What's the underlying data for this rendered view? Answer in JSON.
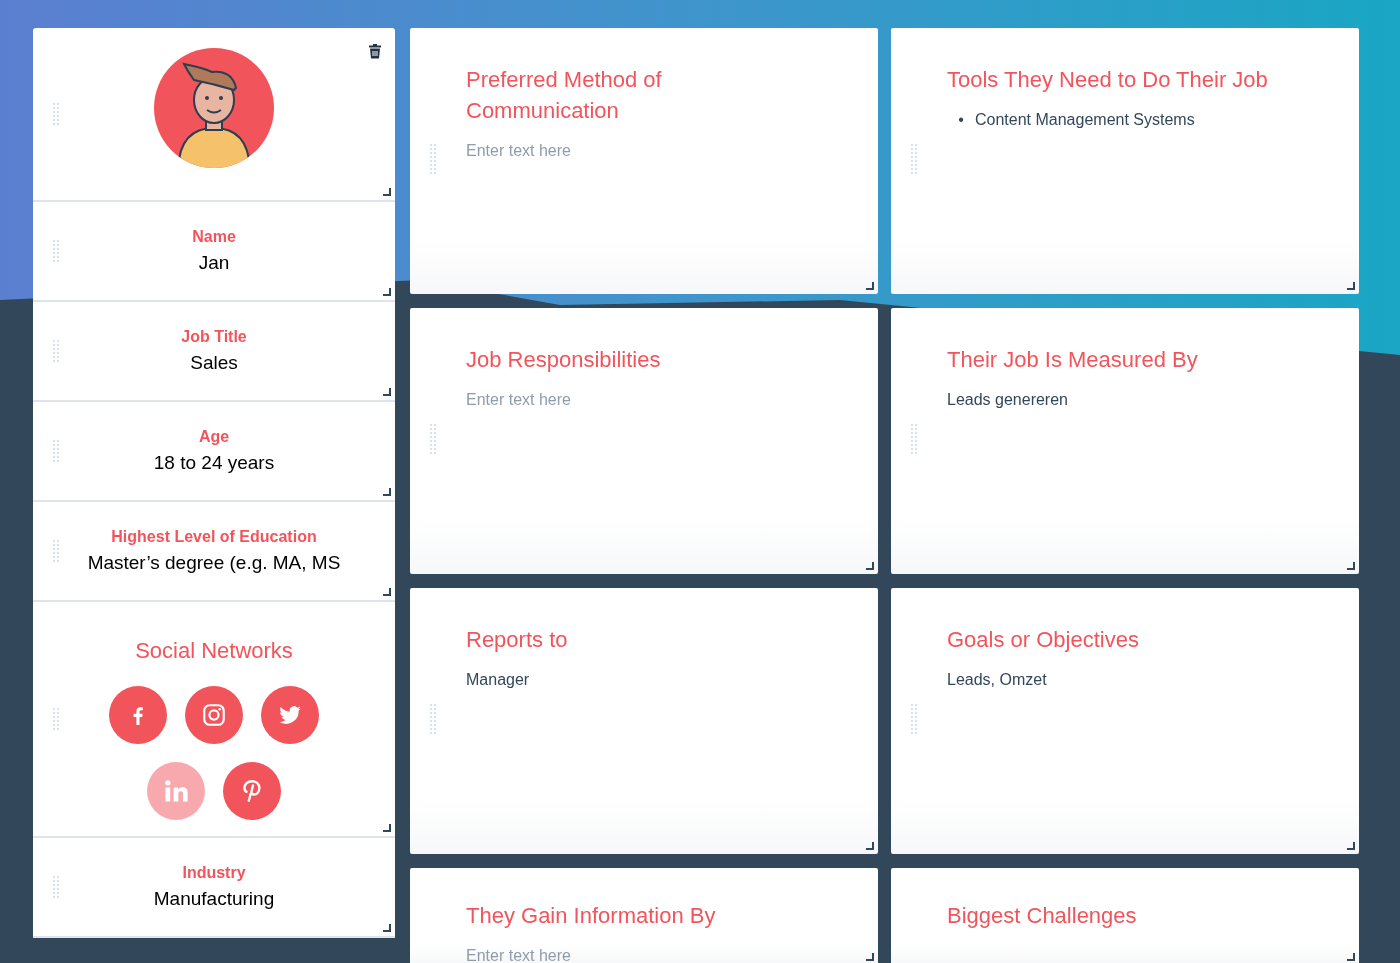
{
  "profile_cards": [
    {
      "kind": "avatar"
    },
    {
      "kind": "field",
      "label": "Name",
      "value": "Jan"
    },
    {
      "kind": "field",
      "label": "Job Title",
      "value": "Sales"
    },
    {
      "kind": "field",
      "label": "Age",
      "value": "18 to 24 years"
    },
    {
      "kind": "field",
      "label": "Highest Level of Education",
      "value": "Master’s degree (e.g. MA, MS"
    },
    {
      "kind": "social",
      "label": "Social Networks",
      "networks": [
        {
          "kind": "facebook",
          "active": true
        },
        {
          "kind": "instagram",
          "active": true
        },
        {
          "kind": "twitter",
          "active": true
        },
        {
          "kind": "linkedin",
          "active": false
        },
        {
          "kind": "pinterest",
          "active": true
        }
      ]
    },
    {
      "kind": "field",
      "label": "Industry",
      "value": "Manufacturing"
    }
  ],
  "detail_cards": [
    {
      "kind": "text",
      "title": "Preferred Method of Communication",
      "placeholder": "Enter text here"
    },
    {
      "kind": "list",
      "title": "Tools They Need to Do Their Job",
      "items": [
        {
          "bullet": "•",
          "text": "Content Management Systems"
        }
      ]
    },
    {
      "kind": "text",
      "title": "Job Responsibilities",
      "placeholder": "Enter text here"
    },
    {
      "kind": "text",
      "title": "Their Job Is Measured By",
      "value": "Leads genereren"
    },
    {
      "kind": "text",
      "title": "Reports to",
      "value": "Manager"
    },
    {
      "kind": "text",
      "title": "Goals or Objectives",
      "value": "Leads, Omzet"
    },
    {
      "kind": "text",
      "title": "They Gain Information By",
      "placeholder": "Enter text here"
    },
    {
      "kind": "text",
      "title": "Biggest Challenges"
    }
  ]
}
